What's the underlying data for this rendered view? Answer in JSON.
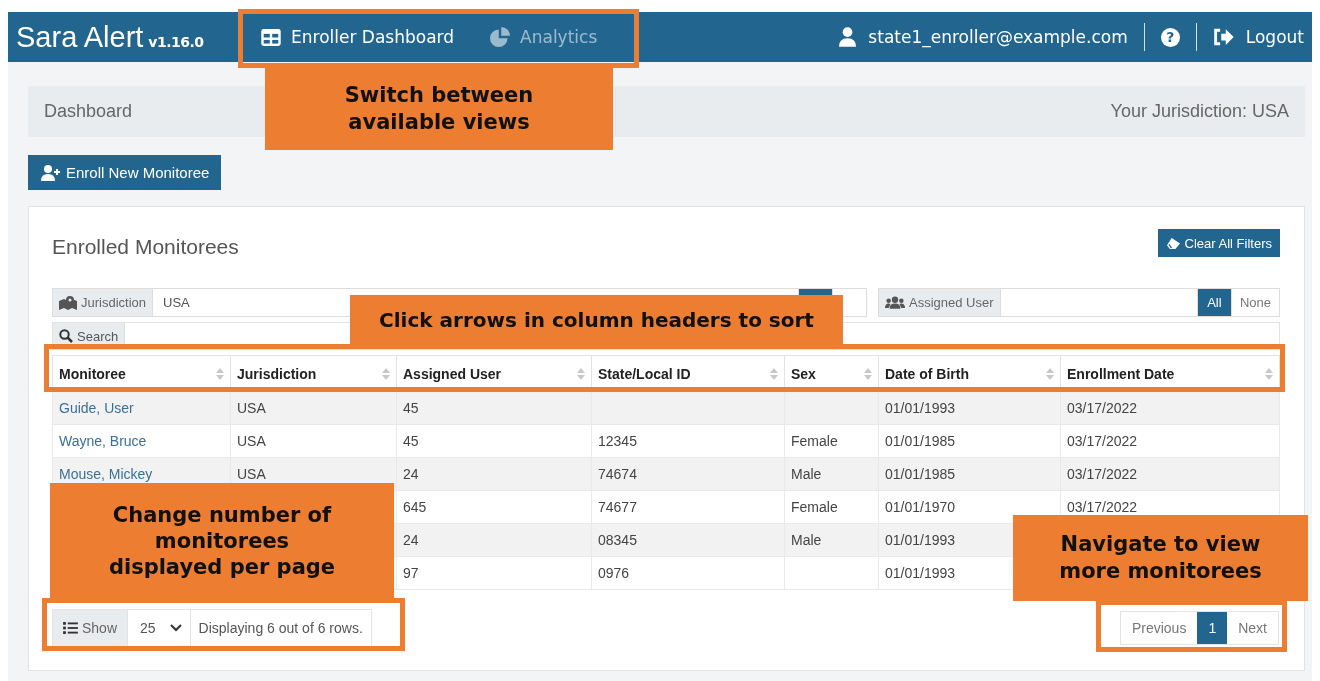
{
  "navbar": {
    "brand": "Sara Alert",
    "version": "v1.16.0",
    "tabs": [
      {
        "label": "Enroller Dashboard",
        "selected": true
      },
      {
        "label": "Analytics",
        "selected": false
      }
    ],
    "user": "state1_enroller@example.com",
    "help": "?",
    "logout": "Logout"
  },
  "breadcrumb": {
    "title": "Dashboard",
    "jurisdiction": "Your Jurisdiction: USA"
  },
  "enroll_button": "Enroll New Monitoree",
  "card": {
    "title": "Enrolled Monitorees",
    "clear_button": "Clear All Filters",
    "filters": [
      {
        "kind": "jurisdiction",
        "label": "Jurisdiction",
        "value": "USA",
        "toggle": [
          {
            "selected": true
          },
          {
            "selected": false
          }
        ]
      },
      {
        "kind": "assigned",
        "label": "Assigned User",
        "toggle": [
          {
            "label": "All",
            "selected": true
          },
          {
            "label": "None",
            "selected": false
          }
        ]
      }
    ],
    "search": {
      "label": "Search"
    },
    "table": {
      "columns": [
        "Monitoree",
        "Jurisdiction",
        "Assigned User",
        "State/Local ID",
        "Sex",
        "Date of Birth",
        "Enrollment Date"
      ],
      "rows": [
        [
          "Guide, User",
          "USA",
          "45",
          null,
          null,
          "01/01/1993",
          "03/17/2022"
        ],
        [
          "Wayne, Bruce",
          "USA",
          "45",
          "12345",
          "Female",
          "01/01/1985",
          "03/17/2022"
        ],
        [
          "Mouse, Mickey",
          "USA",
          "24",
          "74674",
          "Male",
          "01/01/1985",
          "03/17/2022"
        ],
        [
          null,
          null,
          "645",
          "74677",
          "Female",
          "01/01/1970",
          "03/17/2022"
        ],
        [
          null,
          null,
          "24",
          "08345",
          "Male",
          "01/01/1993",
          null
        ],
        [
          null,
          null,
          "97",
          "0976",
          null,
          "01/01/1993",
          null
        ]
      ]
    },
    "footer": {
      "show_label": "Show",
      "per_page": "25",
      "summary": "Displaying 6 out of 6 rows.",
      "pagination": [
        {
          "label": "Previous",
          "selected": false
        },
        {
          "label": "1",
          "selected": true
        },
        {
          "label": "Next",
          "selected": false
        }
      ]
    }
  },
  "annotations": [
    {
      "kind": "views",
      "text": "Switch between\navailable views"
    },
    {
      "kind": "sort",
      "text": "Click arrows in column headers to sort"
    },
    {
      "kind": "per-page",
      "text": "Change number of\nmonitorees\ndisplayed per page"
    },
    {
      "kind": "navigate",
      "text": "Navigate to view\nmore monitorees"
    }
  ]
}
